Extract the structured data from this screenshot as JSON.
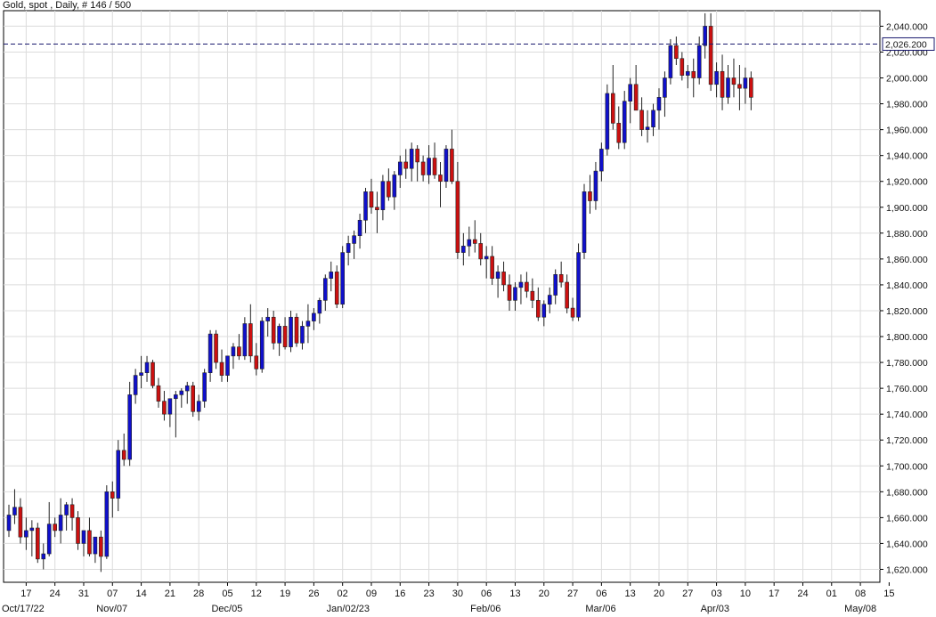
{
  "chart_data": {
    "type": "candlestick",
    "title": "Gold, spot , Daily, # 146 / 500",
    "last_price_label": "2,026.200",
    "last_price": 2026.2,
    "ylim": [
      1610,
      2052
    ],
    "y_ticks": [
      1620,
      1640,
      1660,
      1680,
      1700,
      1720,
      1740,
      1760,
      1780,
      1800,
      1820,
      1840,
      1860,
      1880,
      1900,
      1920,
      1940,
      1960,
      1980,
      2000,
      2020,
      2040
    ],
    "y_tick_labels": [
      "1,620.000",
      "1,640.000",
      "1,660.000",
      "1,680.000",
      "1,700.000",
      "1,720.000",
      "1,740.000",
      "1,760.000",
      "1,780.000",
      "1,800.000",
      "1,820.000",
      "1,840.000",
      "1,860.000",
      "1,880.000",
      "1,900.000",
      "1,920.000",
      "1,940.000",
      "1,960.000",
      "1,980.000",
      "2,000.000",
      "2,020.000",
      "2,040.000"
    ],
    "x_ticks": [
      {
        "i": 3,
        "label": "17"
      },
      {
        "i": 8,
        "label": "24"
      },
      {
        "i": 13,
        "label": "31"
      },
      {
        "i": 18,
        "label": "07"
      },
      {
        "i": 23,
        "label": "14"
      },
      {
        "i": 28,
        "label": "21"
      },
      {
        "i": 33,
        "label": "28"
      },
      {
        "i": 38,
        "label": "05"
      },
      {
        "i": 43,
        "label": "12"
      },
      {
        "i": 48,
        "label": "19"
      },
      {
        "i": 53,
        "label": "26"
      },
      {
        "i": 58,
        "label": "02"
      },
      {
        "i": 63,
        "label": "09"
      },
      {
        "i": 68,
        "label": "16"
      },
      {
        "i": 73,
        "label": "23"
      },
      {
        "i": 78,
        "label": "30"
      },
      {
        "i": 83,
        "label": "06"
      },
      {
        "i": 88,
        "label": "13"
      },
      {
        "i": 93,
        "label": "20"
      },
      {
        "i": 98,
        "label": "27"
      },
      {
        "i": 103,
        "label": "06"
      },
      {
        "i": 108,
        "label": "13"
      },
      {
        "i": 113,
        "label": "20"
      },
      {
        "i": 118,
        "label": "27"
      },
      {
        "i": 123,
        "label": "03"
      },
      {
        "i": 128,
        "label": "10"
      },
      {
        "i": 133,
        "label": "17"
      },
      {
        "i": 138,
        "label": "24"
      },
      {
        "i": 143,
        "label": "01"
      },
      {
        "i": 148,
        "label": "08"
      },
      {
        "i": 153,
        "label": "15"
      }
    ],
    "month_labels": [
      {
        "i": 0,
        "label": "Oct/17/22"
      },
      {
        "i": 18,
        "label": "Nov/07"
      },
      {
        "i": 38,
        "label": "Dec/05"
      },
      {
        "i": 58,
        "label": "Jan/02/23"
      },
      {
        "i": 83,
        "label": "Feb/06"
      },
      {
        "i": 103,
        "label": "Mar/06"
      },
      {
        "i": 123,
        "label": "Apr/03"
      },
      {
        "i": 148,
        "label": "May/08"
      }
    ],
    "up_color": "#1010cc",
    "down_color": "#cc1010",
    "candles": [
      [
        1650,
        1670,
        1645,
        1662
      ],
      [
        1662,
        1682,
        1655,
        1668
      ],
      [
        1668,
        1675,
        1640,
        1645
      ],
      [
        1645,
        1660,
        1635,
        1650
      ],
      [
        1650,
        1658,
        1630,
        1652
      ],
      [
        1652,
        1656,
        1625,
        1628
      ],
      [
        1628,
        1640,
        1620,
        1632
      ],
      [
        1632,
        1672,
        1630,
        1655
      ],
      [
        1655,
        1660,
        1645,
        1650
      ],
      [
        1650,
        1675,
        1640,
        1662
      ],
      [
        1662,
        1672,
        1650,
        1670
      ],
      [
        1670,
        1675,
        1650,
        1660
      ],
      [
        1660,
        1665,
        1635,
        1640
      ],
      [
        1640,
        1650,
        1630,
        1650
      ],
      [
        1650,
        1660,
        1630,
        1632
      ],
      [
        1632,
        1645,
        1625,
        1645
      ],
      [
        1645,
        1650,
        1618,
        1630
      ],
      [
        1630,
        1685,
        1628,
        1680
      ],
      [
        1680,
        1688,
        1660,
        1675
      ],
      [
        1675,
        1720,
        1665,
        1712
      ],
      [
        1712,
        1725,
        1700,
        1705
      ],
      [
        1705,
        1765,
        1700,
        1755
      ],
      [
        1755,
        1775,
        1748,
        1770
      ],
      [
        1770,
        1785,
        1760,
        1772
      ],
      [
        1772,
        1785,
        1765,
        1780
      ],
      [
        1780,
        1782,
        1760,
        1762
      ],
      [
        1762,
        1768,
        1745,
        1750
      ],
      [
        1750,
        1758,
        1735,
        1740
      ],
      [
        1740,
        1752,
        1730,
        1752
      ],
      [
        1752,
        1758,
        1722,
        1755
      ],
      [
        1755,
        1760,
        1745,
        1758
      ],
      [
        1758,
        1765,
        1748,
        1762
      ],
      [
        1762,
        1765,
        1738,
        1742
      ],
      [
        1742,
        1755,
        1735,
        1750
      ],
      [
        1750,
        1775,
        1745,
        1772
      ],
      [
        1772,
        1805,
        1765,
        1802
      ],
      [
        1802,
        1805,
        1775,
        1780
      ],
      [
        1780,
        1790,
        1765,
        1770
      ],
      [
        1770,
        1785,
        1765,
        1785
      ],
      [
        1785,
        1795,
        1775,
        1792
      ],
      [
        1792,
        1802,
        1782,
        1785
      ],
      [
        1785,
        1815,
        1782,
        1810
      ],
      [
        1810,
        1825,
        1780,
        1785
      ],
      [
        1785,
        1795,
        1770,
        1775
      ],
      [
        1775,
        1815,
        1772,
        1812
      ],
      [
        1812,
        1822,
        1800,
        1815
      ],
      [
        1815,
        1820,
        1790,
        1795
      ],
      [
        1795,
        1810,
        1785,
        1808
      ],
      [
        1808,
        1815,
        1790,
        1792
      ],
      [
        1792,
        1820,
        1788,
        1815
      ],
      [
        1815,
        1818,
        1792,
        1795
      ],
      [
        1795,
        1812,
        1790,
        1808
      ],
      [
        1808,
        1825,
        1795,
        1812
      ],
      [
        1812,
        1822,
        1805,
        1818
      ],
      [
        1818,
        1830,
        1810,
        1828
      ],
      [
        1828,
        1848,
        1820,
        1845
      ],
      [
        1845,
        1858,
        1835,
        1850
      ],
      [
        1850,
        1855,
        1822,
        1825
      ],
      [
        1825,
        1870,
        1822,
        1865
      ],
      [
        1865,
        1878,
        1855,
        1872
      ],
      [
        1872,
        1882,
        1860,
        1878
      ],
      [
        1878,
        1895,
        1868,
        1890
      ],
      [
        1890,
        1915,
        1880,
        1912
      ],
      [
        1912,
        1922,
        1895,
        1900
      ],
      [
        1900,
        1912,
        1880,
        1898
      ],
      [
        1898,
        1925,
        1890,
        1920
      ],
      [
        1920,
        1930,
        1905,
        1908
      ],
      [
        1908,
        1928,
        1898,
        1925
      ],
      [
        1925,
        1940,
        1915,
        1935
      ],
      [
        1935,
        1945,
        1922,
        1930
      ],
      [
        1930,
        1950,
        1920,
        1945
      ],
      [
        1945,
        1948,
        1920,
        1935
      ],
      [
        1935,
        1940,
        1920,
        1925
      ],
      [
        1925,
        1948,
        1918,
        1938
      ],
      [
        1938,
        1950,
        1922,
        1925
      ],
      [
        1925,
        1935,
        1900,
        1920
      ],
      [
        1920,
        1948,
        1915,
        1945
      ],
      [
        1945,
        1960,
        1918,
        1920
      ],
      [
        1920,
        1935,
        1860,
        1865
      ],
      [
        1865,
        1880,
        1855,
        1870
      ],
      [
        1870,
        1885,
        1862,
        1875
      ],
      [
        1875,
        1890,
        1865,
        1872
      ],
      [
        1872,
        1880,
        1855,
        1860
      ],
      [
        1860,
        1870,
        1845,
        1862
      ],
      [
        1862,
        1870,
        1840,
        1845
      ],
      [
        1845,
        1855,
        1830,
        1850
      ],
      [
        1850,
        1858,
        1835,
        1840
      ],
      [
        1840,
        1848,
        1820,
        1828
      ],
      [
        1828,
        1842,
        1820,
        1838
      ],
      [
        1838,
        1848,
        1825,
        1842
      ],
      [
        1842,
        1850,
        1830,
        1835
      ],
      [
        1835,
        1845,
        1822,
        1828
      ],
      [
        1828,
        1838,
        1812,
        1815
      ],
      [
        1815,
        1828,
        1808,
        1825
      ],
      [
        1825,
        1838,
        1818,
        1832
      ],
      [
        1832,
        1852,
        1825,
        1848
      ],
      [
        1848,
        1858,
        1838,
        1842
      ],
      [
        1842,
        1848,
        1818,
        1822
      ],
      [
        1822,
        1830,
        1812,
        1815
      ],
      [
        1815,
        1872,
        1812,
        1865
      ],
      [
        1865,
        1918,
        1860,
        1912
      ],
      [
        1912,
        1925,
        1895,
        1905
      ],
      [
        1905,
        1935,
        1898,
        1928
      ],
      [
        1928,
        1950,
        1920,
        1945
      ],
      [
        1945,
        1995,
        1940,
        1988
      ],
      [
        1988,
        2010,
        1960,
        1965
      ],
      [
        1965,
        1978,
        1945,
        1950
      ],
      [
        1950,
        1990,
        1945,
        1982
      ],
      [
        1982,
        2000,
        1965,
        1995
      ],
      [
        1995,
        2010,
        1975,
        1975
      ],
      [
        1975,
        1985,
        1955,
        1960
      ],
      [
        1960,
        1975,
        1950,
        1962
      ],
      [
        1962,
        1980,
        1955,
        1975
      ],
      [
        1975,
        1992,
        1960,
        1985
      ],
      [
        1985,
        2005,
        1970,
        2000
      ],
      [
        2000,
        2030,
        1995,
        2025
      ],
      [
        2025,
        2032,
        2010,
        2015
      ],
      [
        2015,
        2020,
        1998,
        2002
      ],
      [
        2002,
        2010,
        1992,
        2005
      ],
      [
        2005,
        2015,
        1985,
        2000
      ],
      [
        2000,
        2032,
        1995,
        2025
      ],
      [
        2025,
        2050,
        2015,
        2040
      ],
      [
        2040,
        2050,
        1990,
        1995
      ],
      [
        1995,
        2012,
        1985,
        2005
      ],
      [
        2005,
        2018,
        1975,
        1985
      ],
      [
        1985,
        2010,
        1980,
        2000
      ],
      [
        2000,
        2015,
        1985,
        1995
      ],
      [
        1995,
        2010,
        1975,
        1992
      ],
      [
        1992,
        2008,
        1980,
        2000
      ],
      [
        2000,
        2005,
        1975,
        1985
      ]
    ]
  }
}
